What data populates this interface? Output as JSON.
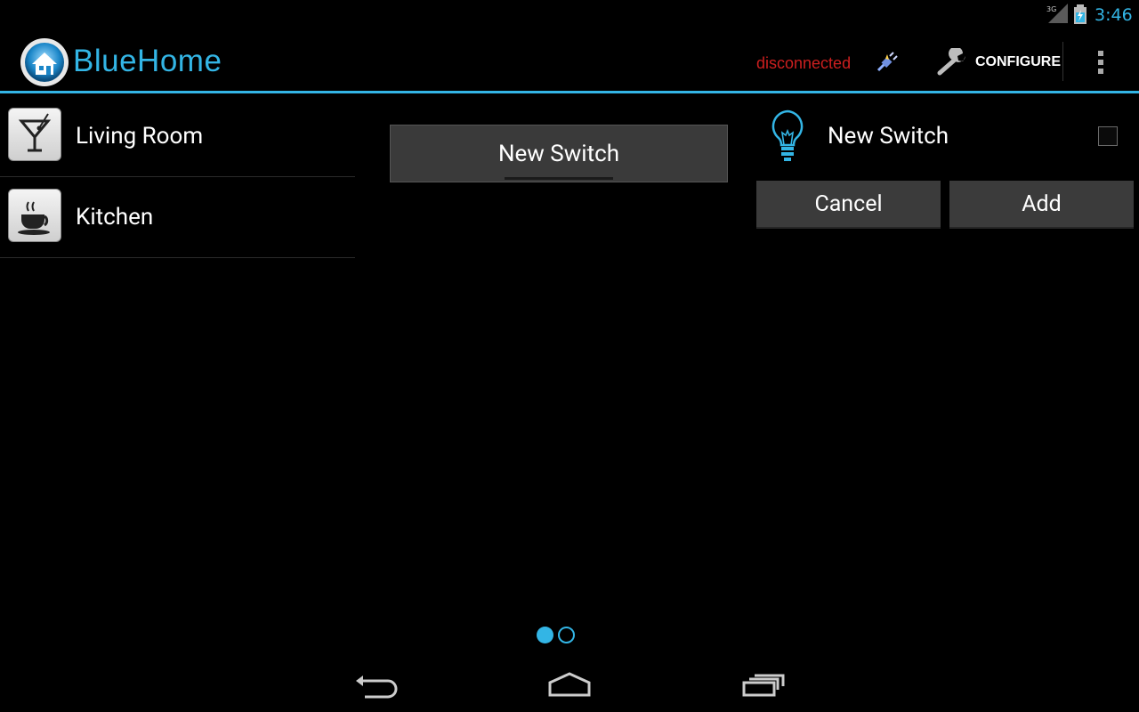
{
  "status_bar": {
    "network": "3G",
    "time": "3:46"
  },
  "action_bar": {
    "title": "BlueHome",
    "connection_status": "disconnected",
    "connection_status_color": "#cc1f1f",
    "configure_label": "CONFIGURE",
    "accent_color": "#33b5e5"
  },
  "rooms": [
    {
      "label": "Living Room",
      "icon": "cocktail-icon"
    },
    {
      "label": "Kitchen",
      "icon": "coffee-cup-icon"
    }
  ],
  "spinner": {
    "selected": "New Switch"
  },
  "new_switch": {
    "icon": "light-bulb-icon",
    "name": "New Switch",
    "checked": false,
    "cancel_label": "Cancel",
    "add_label": "Add"
  },
  "pager": {
    "pages": 2,
    "current": 1
  },
  "nav_bar": {
    "icons": [
      "back-icon",
      "home-icon",
      "recents-icon"
    ]
  }
}
